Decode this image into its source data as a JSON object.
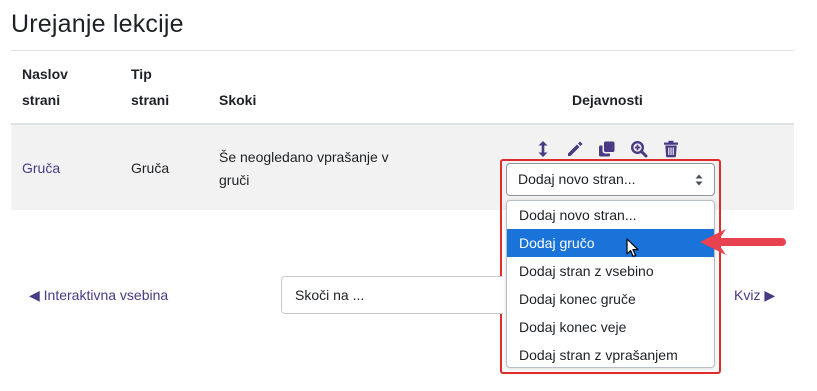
{
  "page": {
    "title": "Urejanje lekcije"
  },
  "table": {
    "headers": {
      "title_line1": "Naslov",
      "title_line2": "strani",
      "type_line1": "Tip",
      "type_line2": "strani",
      "jumps": "Skoki",
      "actions": "Dejavnosti"
    },
    "rows": [
      {
        "title": "Gruča",
        "type": "Gruča",
        "jumps_line1": "Še neogledano vprašanje v",
        "jumps_line2": "gruči"
      }
    ]
  },
  "actions": {
    "icons": [
      "move-icon",
      "edit-icon",
      "duplicate-icon",
      "preview-icon",
      "delete-icon"
    ],
    "add_page_select": {
      "selected": "Dodaj novo stran...",
      "options": [
        "Dodaj novo stran...",
        "Dodaj gručo",
        "Dodaj stran z vsebino",
        "Dodaj konec gruče",
        "Dodaj konec veje",
        "Dodaj stran z vprašanjem"
      ],
      "highlighted": "Dodaj gručo"
    }
  },
  "navigation": {
    "prev": "◀ Interaktivna vsebina",
    "jump_placeholder": "Skoči na ...",
    "next": "Kviz ▶"
  },
  "colors": {
    "link": "#4a3a84",
    "option_selected": "#1a73d9",
    "annotation": "#e02b2b",
    "row_background": "#f2f2f2"
  }
}
